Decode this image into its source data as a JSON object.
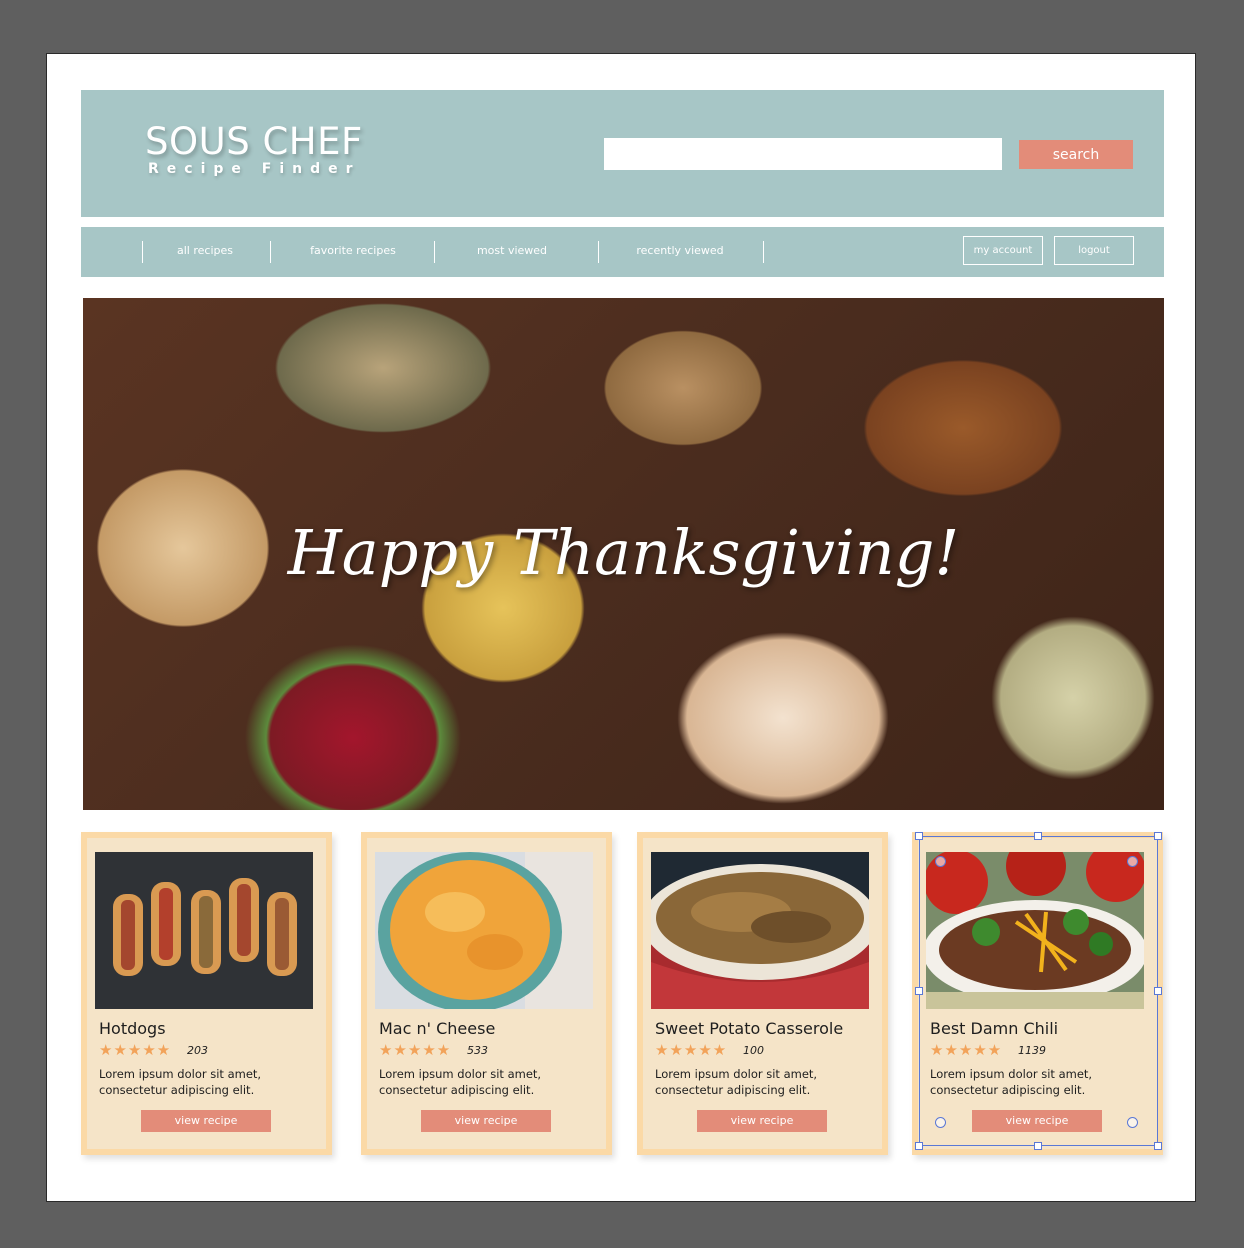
{
  "header": {
    "logo_title": "SOUS CHEF",
    "logo_subtitle": "Recipe Finder",
    "search_placeholder": "",
    "search_button": "search"
  },
  "nav": {
    "items": [
      "all recipes",
      "favorite recipes",
      "most viewed",
      "recently viewed"
    ],
    "account_button": "my account",
    "logout_button": "logout"
  },
  "hero": {
    "title": "Happy Thanksgiving!"
  },
  "cards": [
    {
      "name": "Hotdogs",
      "stars": "★★★★★",
      "rating": 5,
      "count": "203",
      "description": "Lorem ipsum dolor sit amet, consectetur adipiscing elit.",
      "button": "view recipe"
    },
    {
      "name": "Mac n' Cheese",
      "stars": "★★★★★",
      "rating": 5,
      "count": "533",
      "description": "Lorem ipsum dolor sit amet, consectetur adipiscing elit.",
      "button": "view recipe"
    },
    {
      "name": "Sweet Potato Casserole",
      "stars": "★★★★★",
      "rating": 5,
      "count": "100",
      "description": "Lorem ipsum dolor sit amet, consectetur adipiscing elit.",
      "button": "view recipe"
    },
    {
      "name": "Best Damn Chili",
      "stars": "★★★★★",
      "rating": 5,
      "count": "1139",
      "description": "Lorem ipsum dolor sit amet, consectetur adipiscing elit.",
      "button": "view recipe"
    }
  ],
  "colors": {
    "canvas_bg": "#5f5f5f",
    "header_bg": "#a7c6c6",
    "accent": "#e38c79",
    "card_bg": "#f5e4c8",
    "card_border": "#fbd9a6",
    "star": "#f2a35a",
    "selection": "#5a78d6"
  }
}
